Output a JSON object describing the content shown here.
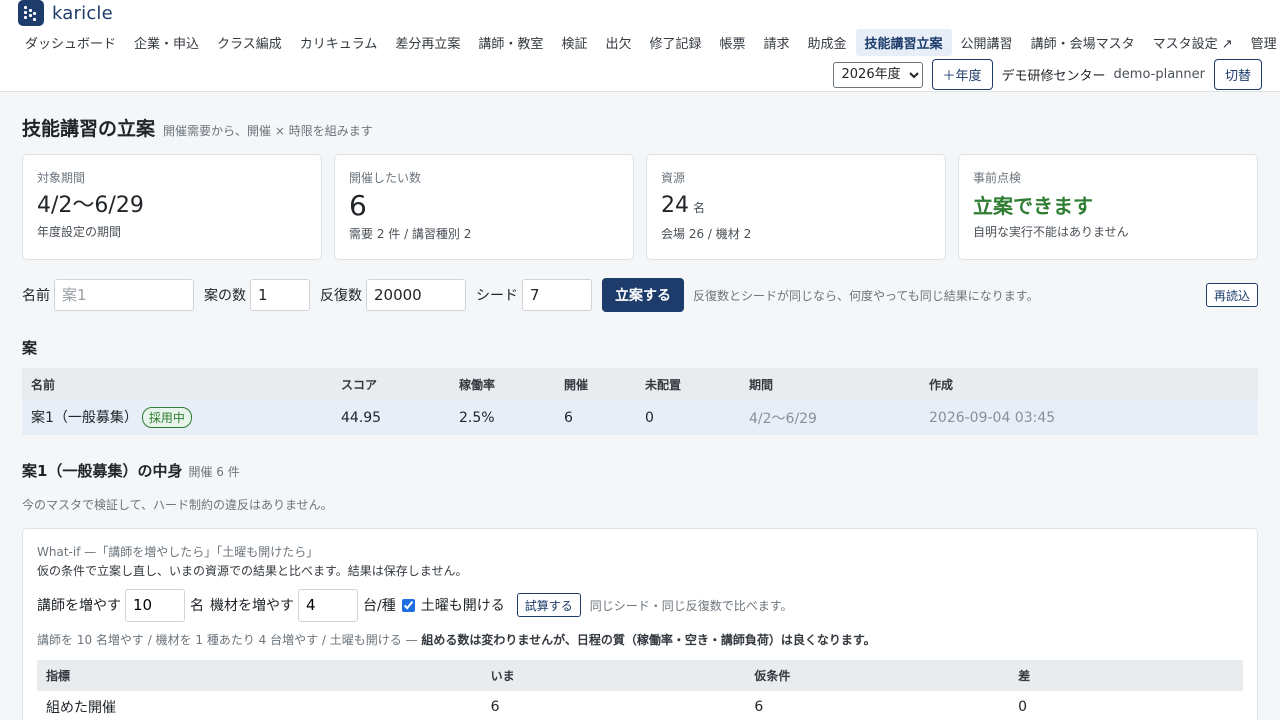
{
  "app": {
    "name": "karicle"
  },
  "nav": [
    {
      "label": "ダッシュボード",
      "active": false
    },
    {
      "label": "企業・申込",
      "active": false
    },
    {
      "label": "クラス編成",
      "active": false
    },
    {
      "label": "カリキュラム",
      "active": false
    },
    {
      "label": "差分再立案",
      "active": false
    },
    {
      "label": "講師・教室",
      "active": false
    },
    {
      "label": "検証",
      "active": false
    },
    {
      "label": "出欠",
      "active": false
    },
    {
      "label": "修了記録",
      "active": false
    },
    {
      "label": "帳票",
      "active": false
    },
    {
      "label": "請求",
      "active": false
    },
    {
      "label": "助成金",
      "active": false
    },
    {
      "label": "技能講習立案",
      "active": true
    },
    {
      "label": "公開講習",
      "active": false
    },
    {
      "label": "講師・会場マスタ",
      "active": false
    },
    {
      "label": "マスタ設定 ↗",
      "active": false
    },
    {
      "label": "管理",
      "active": false
    }
  ],
  "header": {
    "year_selected": "2026年度",
    "add_year_label": "＋年度",
    "org_name": "デモ研修センター",
    "user_name": "demo-planner",
    "switch_label": "切替"
  },
  "page": {
    "title": "技能講習の立案",
    "subtitle": "開催需要から、開催 × 時限を組みます"
  },
  "stats": {
    "period": {
      "label": "対象期間",
      "value": "4/2〜6/29",
      "sub": "年度設定の期間"
    },
    "count": {
      "label": "開催したい数",
      "value": "6",
      "sub": "需要 2 件 / 講習種別 2"
    },
    "resources": {
      "label": "資源",
      "value": "24",
      "unit": "名",
      "sub": "会場 26 / 機材 2"
    },
    "precheck": {
      "label": "事前点検",
      "value": "立案できます",
      "sub": "自明な実行不能はありません",
      "color": "#2e7d32"
    }
  },
  "form": {
    "name_label": "名前",
    "name_placeholder": "案1",
    "plans_label": "案の数",
    "plans_value": "1",
    "iter_label": "反復数",
    "iter_value": "20000",
    "seed_label": "シード",
    "seed_value": "7",
    "submit_label": "立案する",
    "hint": "反復数とシードが同じなら、何度やっても同じ結果になります。",
    "reload_label": "再読込"
  },
  "plans_section": {
    "title": "案",
    "columns": [
      "名前",
      "スコア",
      "稼働率",
      "開催",
      "未配置",
      "期間",
      "作成"
    ],
    "rows": [
      {
        "name": "案1（一般募集）",
        "badge": "採用中",
        "score": "44.95",
        "util": "2.5%",
        "held": "6",
        "unplaced": "0",
        "period": "4/2〜6/29",
        "created": "2026-09-04 03:45"
      }
    ]
  },
  "detail": {
    "title": "案1（一般募集）の中身",
    "count": "開催 6 件",
    "validation": "今のマスタで検証して、ハード制約の違反はありません。"
  },
  "whatif": {
    "title": "What-if —「講師を増やしたら」「土曜も開けたら」",
    "desc": "仮の条件で立案し直し、いまの資源での結果と比べます。結果は保存しません。",
    "teachers_label": "講師を増やす",
    "teachers_value": "10",
    "teachers_unit": "名",
    "equip_label": "機材を増やす",
    "equip_value": "4",
    "equip_unit": "台/種",
    "saturday_label": "土曜も開ける",
    "saturday_checked": true,
    "run_label": "試算する",
    "run_hint": "同じシード・同じ反復数で比べます。",
    "summary_prefix": "講師を 10 名増やす / 機材を 1 種あたり 4 台増やす / 土曜も開ける —",
    "summary_result": "組める数は変わりませんが、日程の質（稼働率・空き・講師負荷）は良くなります。",
    "columns": [
      "指標",
      "いま",
      "仮条件",
      "差"
    ],
    "rows": [
      {
        "metric": "組めた開催",
        "now": "6",
        "hypo": "6",
        "diff": "0"
      }
    ]
  },
  "colors": {
    "brand": "#1d3c6b",
    "success": "#2e7d32",
    "active_row": "#e7eef8"
  }
}
